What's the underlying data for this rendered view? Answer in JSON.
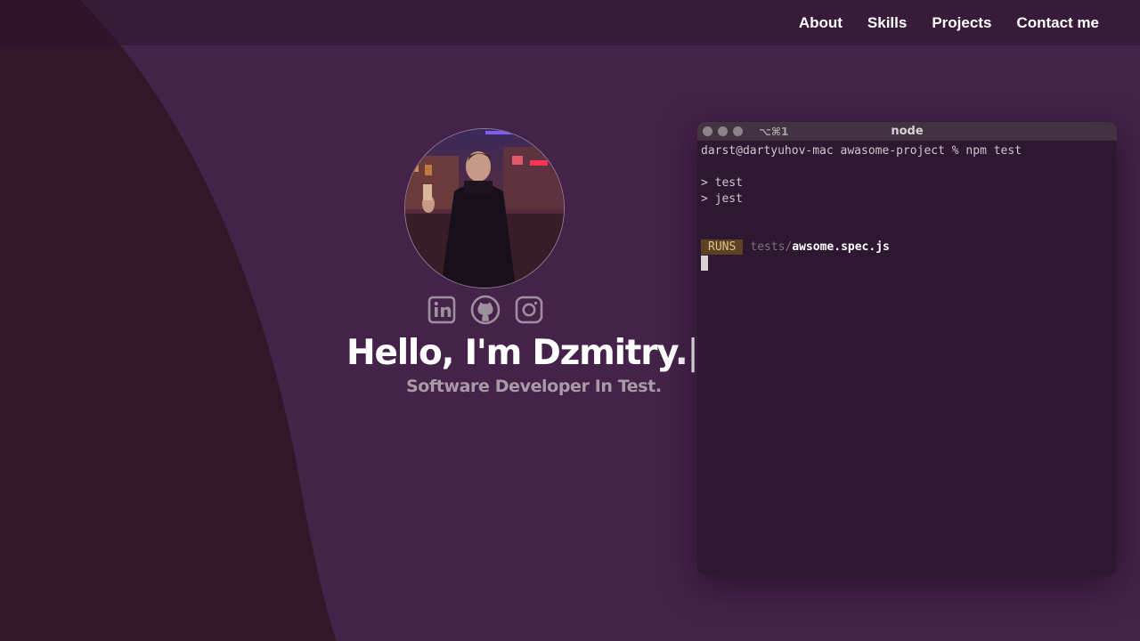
{
  "nav": {
    "items": [
      {
        "label": "About"
      },
      {
        "label": "Skills"
      },
      {
        "label": "Projects"
      },
      {
        "label": "Contact me"
      }
    ]
  },
  "hero": {
    "greeting": "Hello, I'm Dzmitry.",
    "cursor": "|",
    "subtitle": "Software Developer In Test."
  },
  "socials": {
    "icons": [
      "linkedin-icon",
      "github-icon",
      "instagram-icon"
    ]
  },
  "terminal": {
    "shortcut": "⌥⌘1",
    "title": "node",
    "prompt": "darst@dartyuhov-mac awasome-project % npm test",
    "out1": "> test",
    "out2": "> jest",
    "runs_badge": "RUNS",
    "test_dir": "tests/",
    "test_file": "awsome.spec.js"
  },
  "colors": {
    "background": "#45224a",
    "curve": "#351629",
    "navbar": "#35192f",
    "terminal": "#2e1731"
  }
}
